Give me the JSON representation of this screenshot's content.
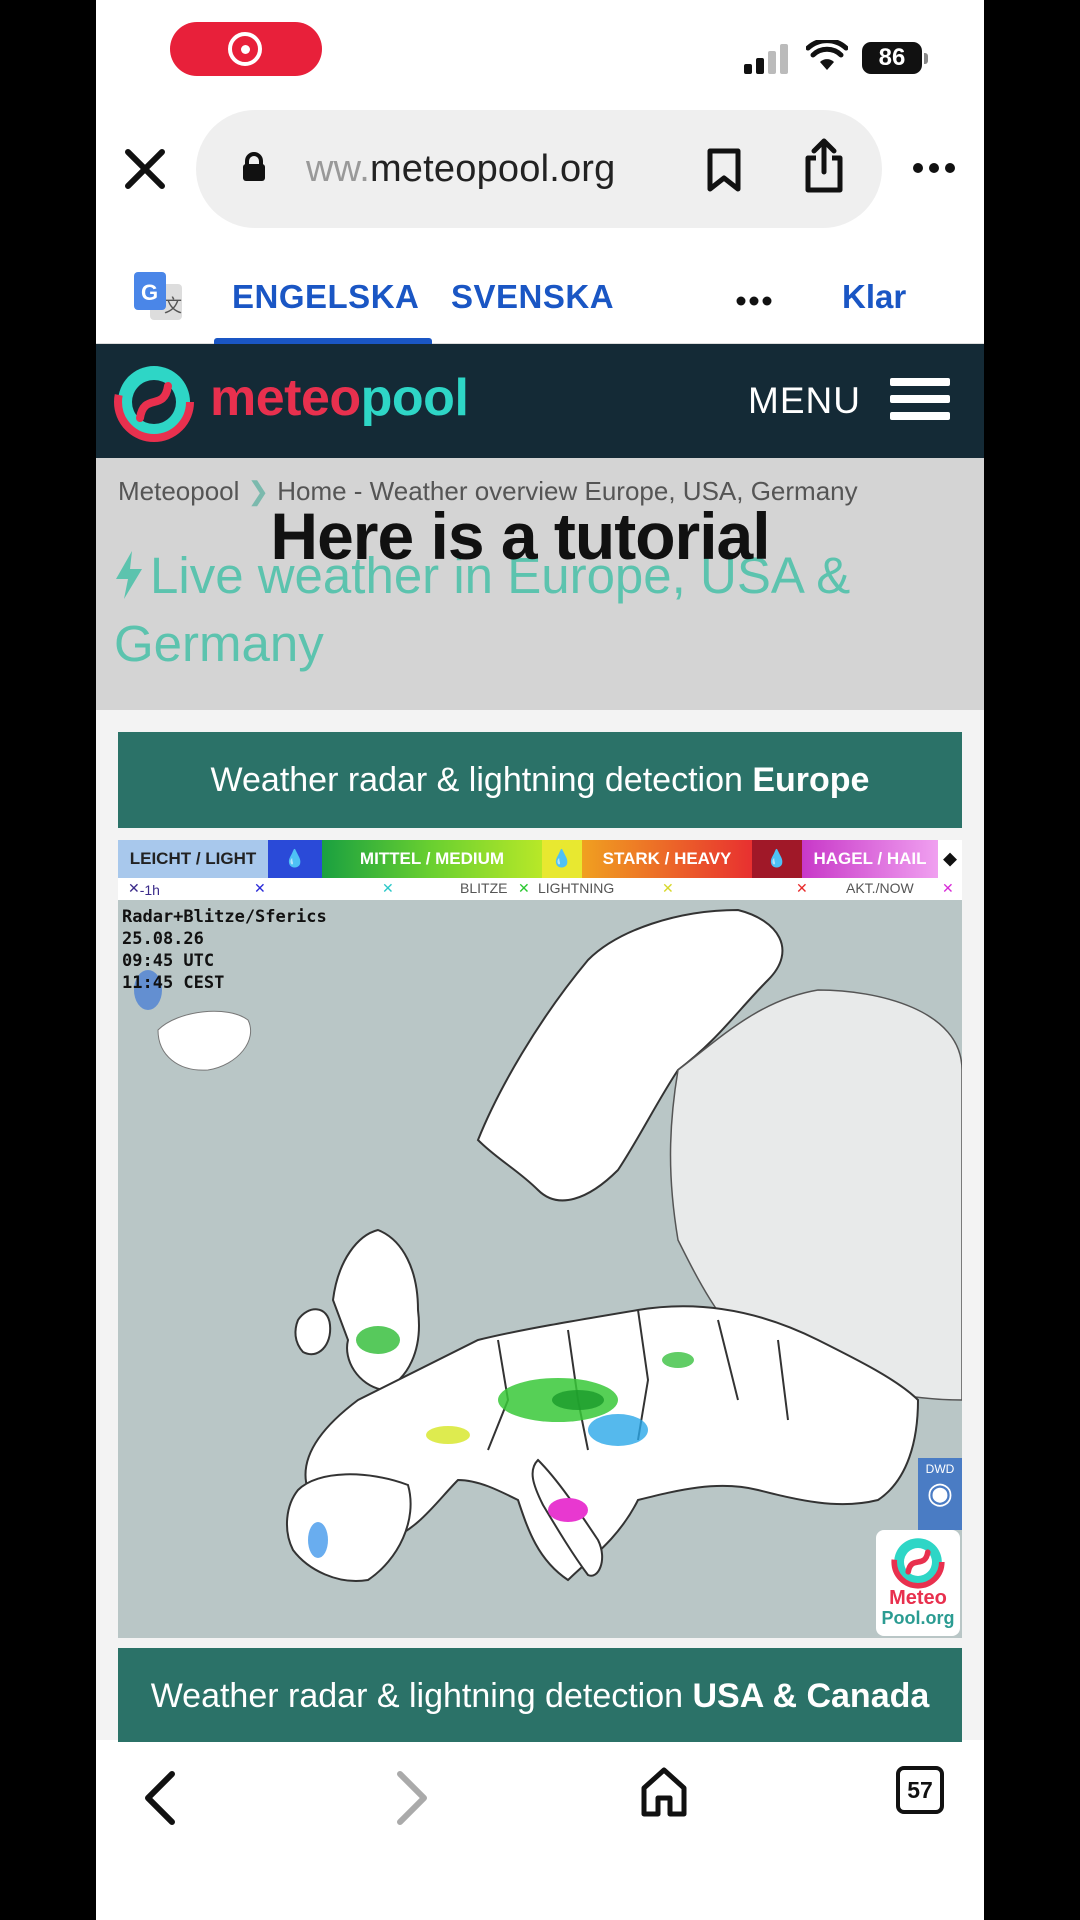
{
  "status_bar": {
    "battery": "86"
  },
  "browser": {
    "url_faded": "ww.",
    "url_main": "meteopool.org"
  },
  "translate_bar": {
    "tab_source": "ENGELSKA",
    "tab_target": "SVENSKA",
    "done_label": "Klar"
  },
  "site_header": {
    "logo_part1": "meteo",
    "logo_part2": "pool",
    "menu_label": "MENU"
  },
  "intro": {
    "breadcrumb_root": "Meteopool",
    "breadcrumb_current": "Home - Weather overview Europe, USA, Germany",
    "heading": "Live weather in Europe, USA & Germany",
    "overlay_title": "Here is a tutorial"
  },
  "cards": [
    {
      "title_prefix": "Weather radar & lightning detection ",
      "title_bold": "Europe"
    },
    {
      "title_prefix": "Weather radar & lightning detection ",
      "title_bold": "USA & Canada"
    }
  ],
  "radar": {
    "legend": [
      "LEICHT / LIGHT",
      "MITTEL / MEDIUM",
      "STARK / HEAVY",
      "HAGEL / HAIL"
    ],
    "legend_row2_left": "-1h",
    "legend_row2_mid": "BLITZE",
    "legend_row2_mid2": "LIGHTNING",
    "legend_row2_right": "AKT./NOW",
    "info_title": "Radar+Blitze/Sferics",
    "info_date": "25.08.26",
    "info_utc": "09:45 UTC",
    "info_cest": "11:45 CEST",
    "dwd_label": "DWD",
    "badge_line1": "Meteo",
    "badge_line2": "Pool.org"
  },
  "toolbar": {
    "tab_count": "57"
  }
}
